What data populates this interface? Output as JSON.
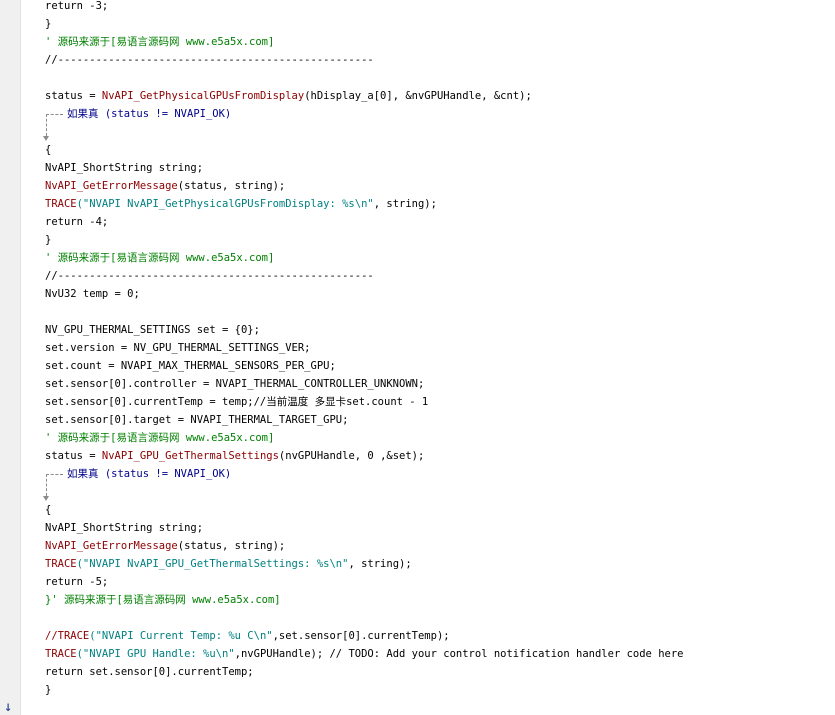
{
  "editor": {
    "lines": {
      "l1": "return -3;",
      "l2": "}",
      "l3": "' 源码来源于[易语言源码网 www.e5a5x.com]",
      "l4": "//--------------------------------------------------",
      "l6a": "status = ",
      "l6b": "NvAPI_GetPhysicalGPUsFromDisplay",
      "l6c": "(hDisplay_a[0], &nvGPUHandle, &cnt);",
      "l7": "如果真 (status != NVAPI_OK)",
      "l9": "{",
      "l10": "NvAPI_ShortString string;",
      "l11a": "NvAPI_GetErrorMessage",
      "l11b": "(status, string);",
      "l12a": "TRACE",
      "l12b": "(\"NVAPI NvAPI_GetPhysicalGPUsFromDisplay: %s\\n\"",
      "l12c": ", string);",
      "l13": "return -4;",
      "l14": "}",
      "l15": "' 源码来源于[易语言源码网 www.e5a5x.com]",
      "l16": "//--------------------------------------------------",
      "l17": "NvU32 temp = 0;",
      "l19": "NV_GPU_THERMAL_SETTINGS set = {0};",
      "l20": "set.version = NV_GPU_THERMAL_SETTINGS_VER;",
      "l21": "set.count = NVAPI_MAX_THERMAL_SENSORS_PER_GPU;",
      "l22": "set.sensor[0].controller = NVAPI_THERMAL_CONTROLLER_UNKNOWN;",
      "l23": "set.sensor[0].currentTemp = temp;//当前温度 多显卡set.count - 1",
      "l24": "set.sensor[0].target = NVAPI_THERMAL_TARGET_GPU;",
      "l25": "' 源码来源于[易语言源码网 www.e5a5x.com]",
      "l26a": "status = ",
      "l26b": "NvAPI_GPU_GetThermalSettings",
      "l26c": "(nvGPUHandle, 0 ,&set);",
      "l27": "如果真 (status != NVAPI_OK)",
      "l29": "{",
      "l30": "NvAPI_ShortString string;",
      "l31a": "NvAPI_GetErrorMessage",
      "l31b": "(status, string);",
      "l32a": "TRACE",
      "l32b": "(\"NVAPI NvAPI_GPU_GetThermalSettings: %s\\n\"",
      "l32c": ", string);",
      "l33": "return -5;",
      "l34": "}' 源码来源于[易语言源码网 www.e5a5x.com]",
      "l36a": "//TRACE",
      "l36b": "(\"NVAPI Current Temp: %u C\\n\"",
      "l36c": ",set.sensor[0].currentTemp);",
      "l37a": "TRACE",
      "l37b": "(\"NVAPI GPU Handle: %u\\n\"",
      "l37c": ",nvGPUHandle); // TODO: Add your control notification handler code here",
      "l38": "return set.sensor[0].currentTemp;",
      "l39": "}"
    }
  },
  "scroll": {
    "down_arrow": "↓"
  }
}
